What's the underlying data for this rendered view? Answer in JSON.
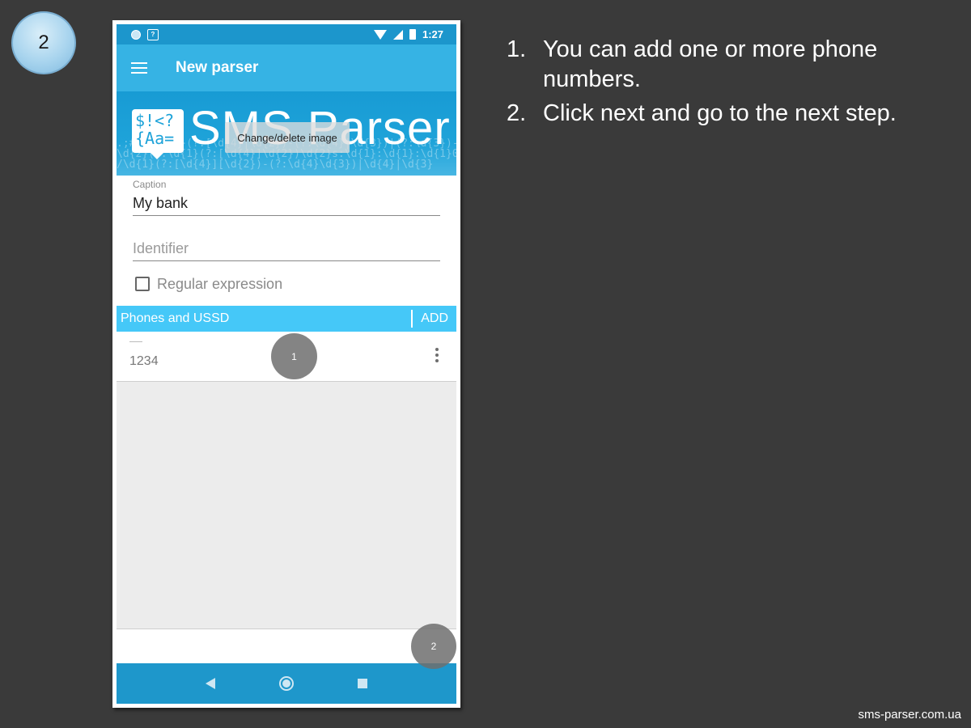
{
  "slide": {
    "step_number": "2",
    "footer_text": "sms-parser.com.ua"
  },
  "statusbar": {
    "time": "1:27",
    "icons": [
      "circle-notification-icon",
      "sim-card-icon",
      "wifi-icon",
      "cell-signal-icon",
      "battery-icon"
    ]
  },
  "appbar": {
    "menu_icon": "menu-icon",
    "title": "New parser"
  },
  "banner": {
    "logo_symbols": "$!<?\n{Aa=",
    "logo_text": "SMS Parser",
    "change_image_label": "Change/delete image"
  },
  "form": {
    "caption_label": "Caption",
    "caption_value": "My bank",
    "identifier_placeholder": "Identifier",
    "regex_label": "Regular expression",
    "regex_checked": false
  },
  "phones_section": {
    "title": "Phones and USSD",
    "add_label": "ADD",
    "items": [
      {
        "number": "1234"
      }
    ]
  },
  "callouts": {
    "first": "1",
    "second": "2"
  },
  "navbar": {
    "icons": [
      "back-icon",
      "home-icon",
      "recent-apps-icon"
    ]
  },
  "instructions": [
    {
      "num": "1.",
      "text": "You can add one or more phone numbers."
    },
    {
      "num": "2.",
      "text": "Click next and go to the next step."
    }
  ],
  "colors": {
    "background": "#3a3a3a",
    "statusbar": "#1c96cc",
    "appbar": "#36b3e4",
    "section_header": "#45c8f8",
    "navbar": "#1e97cb"
  }
}
